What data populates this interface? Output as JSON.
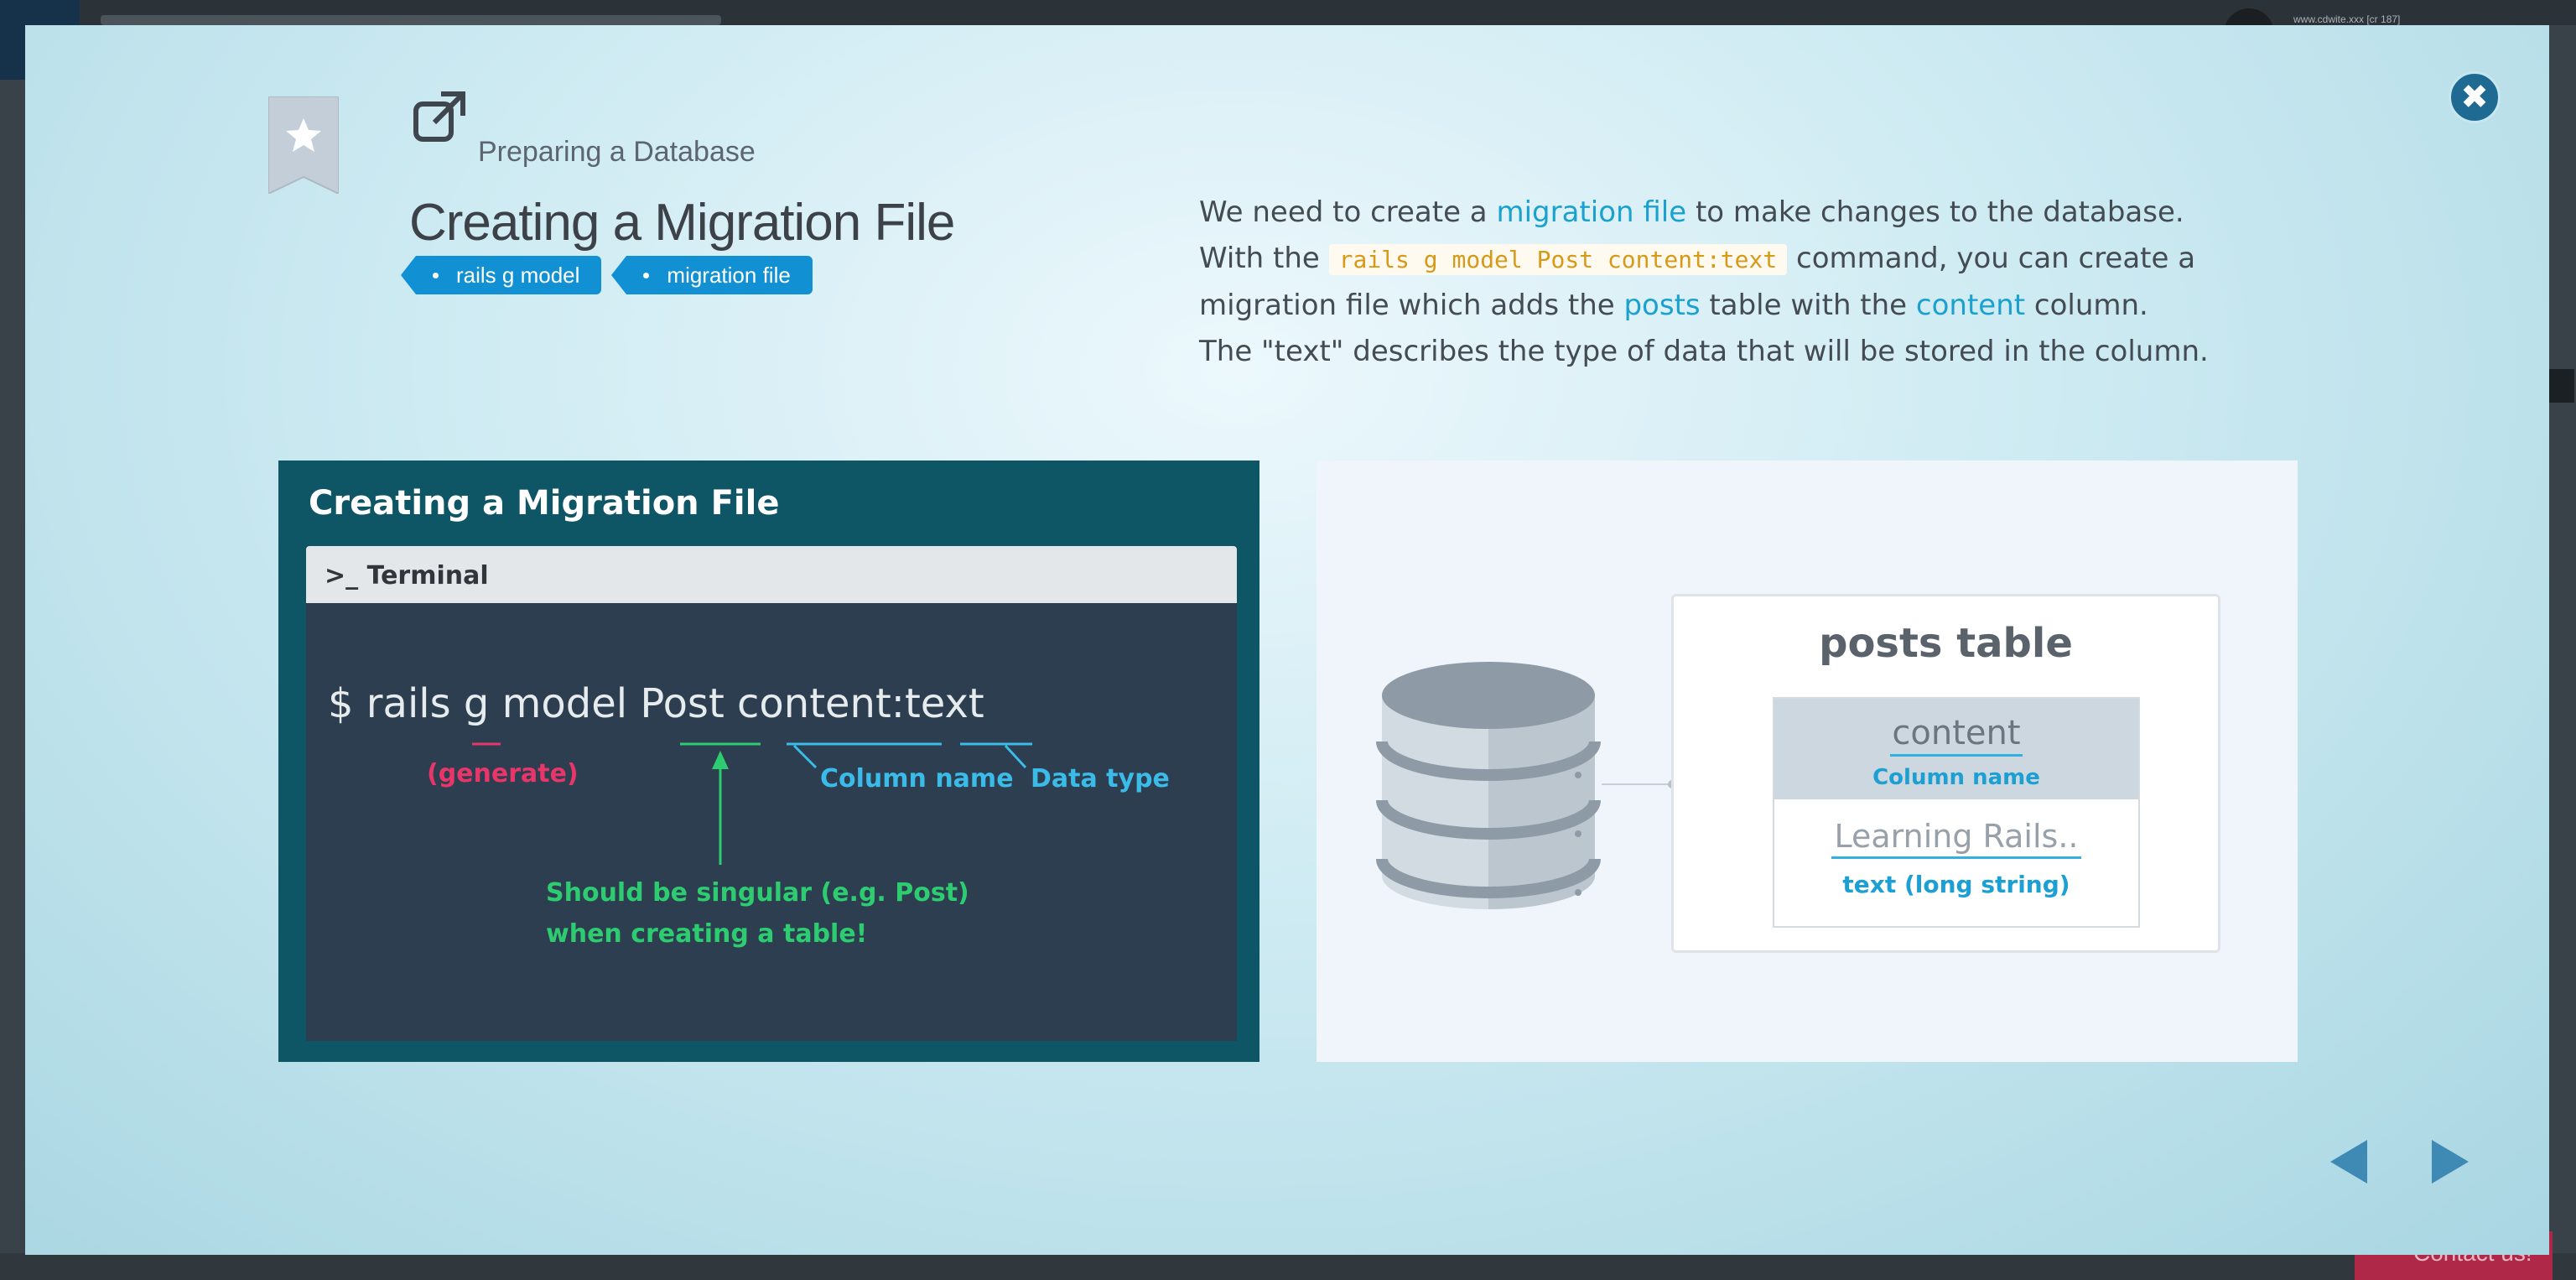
{
  "background": {
    "url_text": "www.cdwite.xxx [cr 187]",
    "contact_label": "Contact us!"
  },
  "modal": {
    "breadcrumb": "Preparing a Database",
    "title": "Creating a Migration File",
    "tags": [
      "rails g model",
      "migration file"
    ],
    "description": {
      "l1_a": "We need to create a ",
      "l1_hl": "migration file",
      "l1_b": " to make changes to the database.",
      "l2_a": "With the ",
      "l2_code": "rails g model Post content:text",
      "l2_b": " command, you can create a",
      "l3_a": "migration file which adds the ",
      "l3_hl1": "posts",
      "l3_b": " table with the ",
      "l3_hl2": "content",
      "l3_c": " column.",
      "l4": "The \"text\" describes the type of data that will be stored in the column."
    },
    "slide_left": {
      "title": "Creating a Migration File",
      "terminal_label": "Terminal",
      "command": "$ rails g model Post content:text",
      "ann_generate": "(generate)",
      "ann_column_name": "Column name",
      "ann_data_type": "Data type",
      "ann_singular_1": "Should be singular (e.g. Post)",
      "ann_singular_2": "when creating a table!"
    },
    "slide_right": {
      "table_title": "posts table",
      "column_name": "content",
      "column_sub": "Column name",
      "cell_value": "Learning Rails..",
      "cell_sub": "text (long string)"
    },
    "colors": {
      "accent": "#1191d3",
      "highlight": "#1aa1d0",
      "slide_bg": "#0e5566",
      "terminal_bg": "#2c3e50"
    }
  }
}
